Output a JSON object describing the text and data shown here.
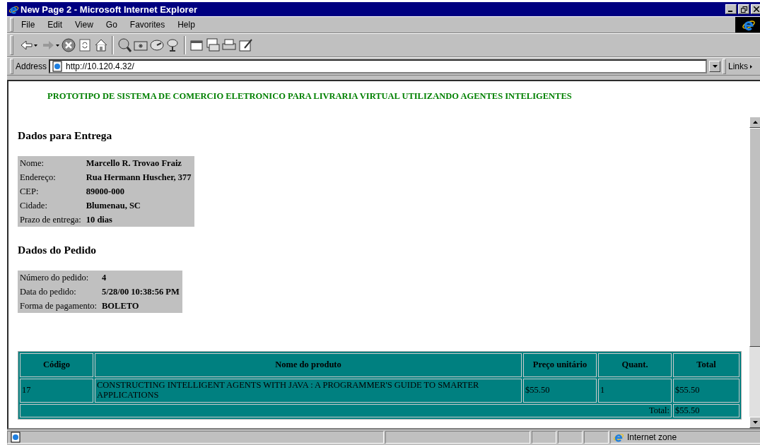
{
  "window": {
    "title": "New Page 2 - Microsoft Internet Explorer"
  },
  "menu": [
    {
      "label": "File"
    },
    {
      "label": "Edit"
    },
    {
      "label": "View"
    },
    {
      "label": "Go"
    },
    {
      "label": "Favorites"
    },
    {
      "label": "Help"
    }
  ],
  "address_bar": {
    "label": "Address",
    "value": "http://10.120.4.32/",
    "links": "Links"
  },
  "page": {
    "banner": "PROTOTIPO DE SISTEMA DE COMERCIO ELETRONICO PARA LIVRARIA VIRTUAL UTILIZANDO AGENTES INTELIGENTES",
    "delivery": {
      "heading": "Dados para Entrega",
      "rows": [
        {
          "label": "Nome:",
          "value": "Marcello R. Trovao Fraiz"
        },
        {
          "label": "Endereço:",
          "value": "Rua Hermann Huscher, 377"
        },
        {
          "label": "CEP:",
          "value": "89000-000"
        },
        {
          "label": "Cidade:",
          "value": "Blumenau, SC"
        },
        {
          "label": "Prazo de entrega:",
          "value": "10 dias"
        }
      ]
    },
    "order": {
      "heading": "Dados do Pedido",
      "rows": [
        {
          "label": "Número do pedido:",
          "value": "4"
        },
        {
          "label": "Data do pedido:",
          "value": "5/28/00 10:38:56 PM"
        },
        {
          "label": "Forma de pagamento:",
          "value": "BOLETO"
        }
      ]
    },
    "table": {
      "columns": [
        "Código",
        "Nome do produto",
        "Preço unitário",
        "Quant.",
        "Total"
      ],
      "rows": [
        [
          "17",
          "CONSTRUCTING INTELLIGENT AGENTS WITH JAVA : A PROGRAMMER'S GUIDE TO SMARTER APPLICATIONS",
          "$55.50",
          "1",
          "$55.50"
        ]
      ],
      "total_label": "Total:",
      "total_value": "$55.50"
    }
  },
  "status_bar": {
    "zone": "Internet zone"
  }
}
